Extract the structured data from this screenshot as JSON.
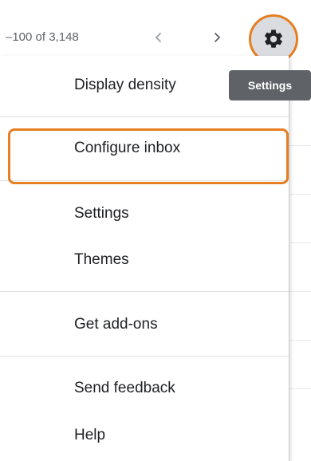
{
  "toolbar": {
    "pager_text": "–100 of 3,148",
    "prev_icon": "chevron-left-icon",
    "next_icon": "chevron-right-icon",
    "settings_icon": "gear-icon"
  },
  "tooltip": {
    "label": "Settings"
  },
  "menu": {
    "items": [
      {
        "label": "Display density"
      },
      {
        "label": "Configure inbox"
      },
      {
        "label": "Settings"
      },
      {
        "label": "Themes"
      },
      {
        "label": "Get add-ons"
      },
      {
        "label": "Send feedback"
      },
      {
        "label": "Help"
      }
    ]
  },
  "colors": {
    "highlight": "#e67e22",
    "tooltip_bg": "#5f6368",
    "gear_bg": "#dadce0"
  }
}
